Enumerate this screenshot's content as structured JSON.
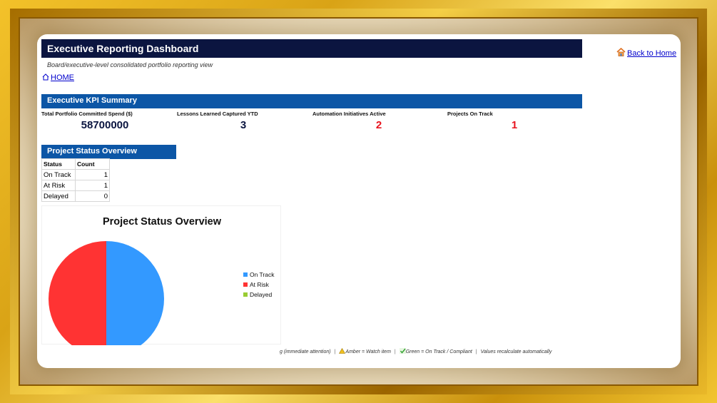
{
  "header": {
    "title": "Executive Reporting Dashboard",
    "subtitle": "Board/executive-level consolidated portfolio reporting view",
    "home_label": "HOME",
    "back_label": "Back to Home"
  },
  "kpi": {
    "section_title": "Executive KPI Summary",
    "items": [
      {
        "label": "Total Portfolio Committed Spend ($)",
        "value": "58700000",
        "color": "#0b1540"
      },
      {
        "label": "Lessons Learned Captured YTD",
        "value": "3",
        "color": "#0b1540"
      },
      {
        "label": "Automation Initiatives Active",
        "value": "2",
        "color": "#e8141e"
      },
      {
        "label": "Projects On Track",
        "value": "1",
        "color": "#e8141e"
      }
    ]
  },
  "status": {
    "section_title": "Project Status Overview",
    "columns": [
      "Status",
      "Count"
    ],
    "rows": [
      {
        "status": "On Track",
        "count": "1"
      },
      {
        "status": "At Risk",
        "count": "1"
      },
      {
        "status": "Delayed",
        "count": "0"
      }
    ]
  },
  "chart_data": {
    "type": "pie",
    "title": "Project Status Overview",
    "categories": [
      "On Track",
      "At Risk",
      "Delayed"
    ],
    "values": [
      1,
      1,
      0
    ],
    "colors": [
      "#3399ff",
      "#ff3333",
      "#99cc33"
    ],
    "legend": "right"
  },
  "footer": {
    "red_note": "g (immediate attention)",
    "amber_note": "Amber = Watch item",
    "green_note": "Green = On Track / Compliant",
    "recalc_note": "Values recalculate automatically"
  },
  "colors": {
    "title_bg": "#0b1540",
    "section_bg": "#0c56a6",
    "link": "#0000cc"
  },
  "icons": {
    "back": "house-icon",
    "home": "house-outline-icon",
    "amber": "warning-icon",
    "green": "check-icon"
  }
}
